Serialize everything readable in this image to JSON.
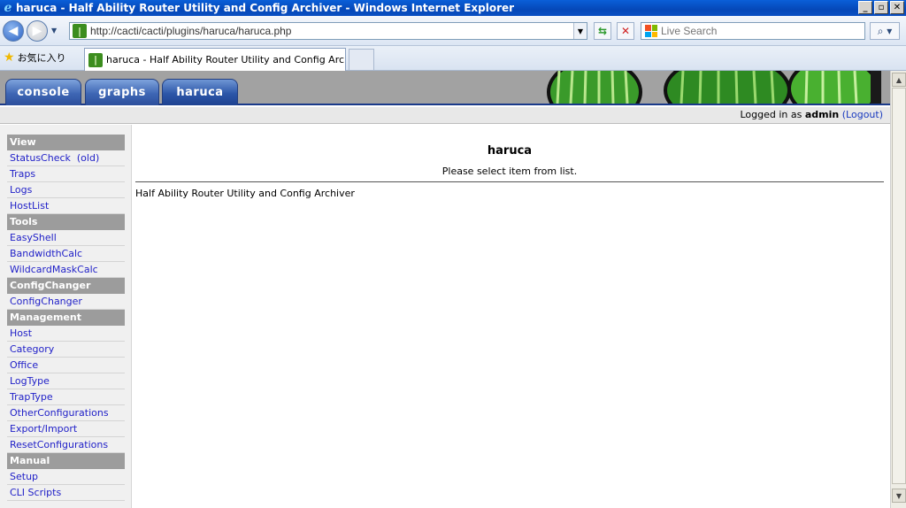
{
  "window": {
    "title": "haruca - Half Ability Router Utility and Config Archiver - Windows Internet Explorer",
    "controls": [
      "_",
      "▫",
      "✕"
    ]
  },
  "toolbar": {
    "url": "http://cacti/cacti/plugins/haruca/haruca.php",
    "search_placeholder": "Live Search"
  },
  "tabs_bar": {
    "favorites_label": "お気に入り",
    "active_tab_label": "haruca - Half Ability Router Utility and Config Arc..."
  },
  "cacti": {
    "tabs": [
      {
        "label": "console"
      },
      {
        "label": "graphs"
      },
      {
        "label": "haruca"
      }
    ],
    "login": {
      "prefix": "Logged in as ",
      "user": "admin",
      "logout_label": "(Logout)"
    }
  },
  "sidebar": {
    "sections": [
      {
        "title": "View",
        "items": [
          "StatusCheck  (old)",
          "Traps",
          "Logs",
          "HostList"
        ]
      },
      {
        "title": "Tools",
        "items": [
          "EasyShell",
          "BandwidthCalc",
          "WildcardMaskCalc"
        ]
      },
      {
        "title": "ConfigChanger",
        "items": [
          "ConfigChanger"
        ]
      },
      {
        "title": "Management",
        "items": [
          "Host",
          "Category",
          "Office",
          "LogType",
          "TrapType",
          "OtherConfigurations",
          "Export/Import",
          "ResetConfigurations"
        ]
      },
      {
        "title": "Manual",
        "items": [
          "Setup",
          "CLI Scripts"
        ]
      }
    ]
  },
  "main": {
    "title": "haruca",
    "hint": "Please select item from list.",
    "description": "Half Ability Router Utility and Config Archiver"
  },
  "colors": {
    "tab_blue": "#3e66b4",
    "header_gray": "#a2a2a2",
    "link": "#2121c8",
    "section_gray": "#9c9c9c"
  }
}
